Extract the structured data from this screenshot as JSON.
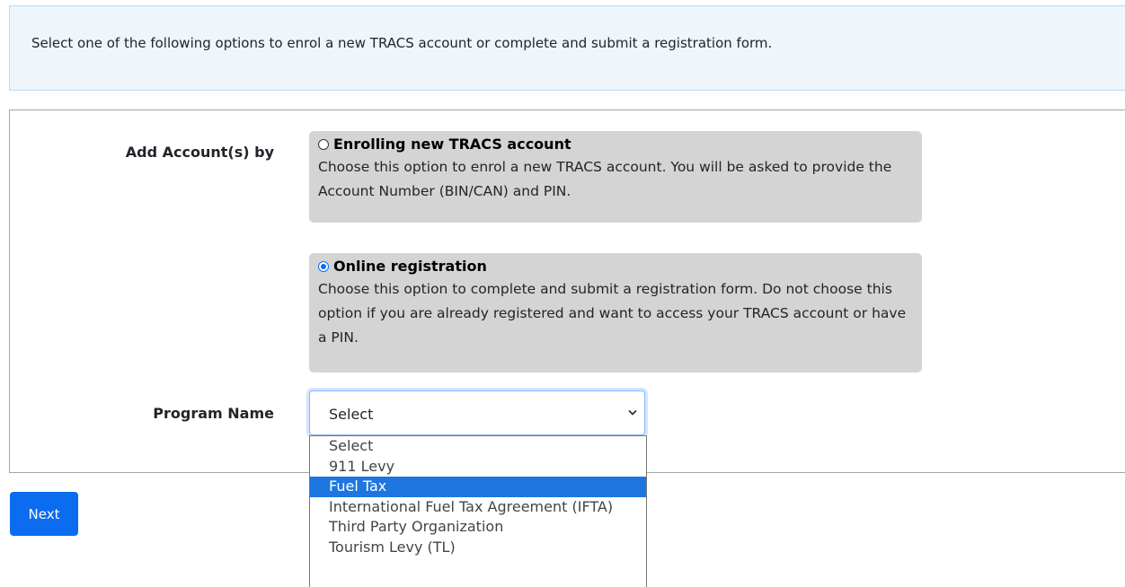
{
  "info": {
    "text": "Select one of the following options to enrol a new TRACS account or complete and submit a registration form."
  },
  "form": {
    "add_account_label": "Add Account(s) by",
    "options": [
      {
        "title": "Enrolling new TRACS account",
        "description": "Choose this option to enrol a new TRACS account. You will be asked to provide the Account Number (BIN/CAN) and PIN.",
        "checked": false
      },
      {
        "title": "Online registration",
        "description": "Choose this option to complete and submit a registration form. Do not choose this option if you are already registered and want to access your TRACS account or have a PIN.",
        "checked": true
      }
    ],
    "program_label": "Program Name",
    "program_select": {
      "value": "Select",
      "options": [
        "Select",
        "911 Levy",
        "Fuel Tax",
        "International Fuel Tax Agreement (IFTA)",
        "Third Party Organization",
        "Tourism Levy (TL)"
      ],
      "highlighted": "Fuel Tax"
    }
  },
  "actions": {
    "next_label": "Next"
  },
  "colors": {
    "primary": "#0b6cf0",
    "info_bg": "#eef6fc",
    "card_bg": "#d4d4d4",
    "highlight": "#1e76e1"
  }
}
